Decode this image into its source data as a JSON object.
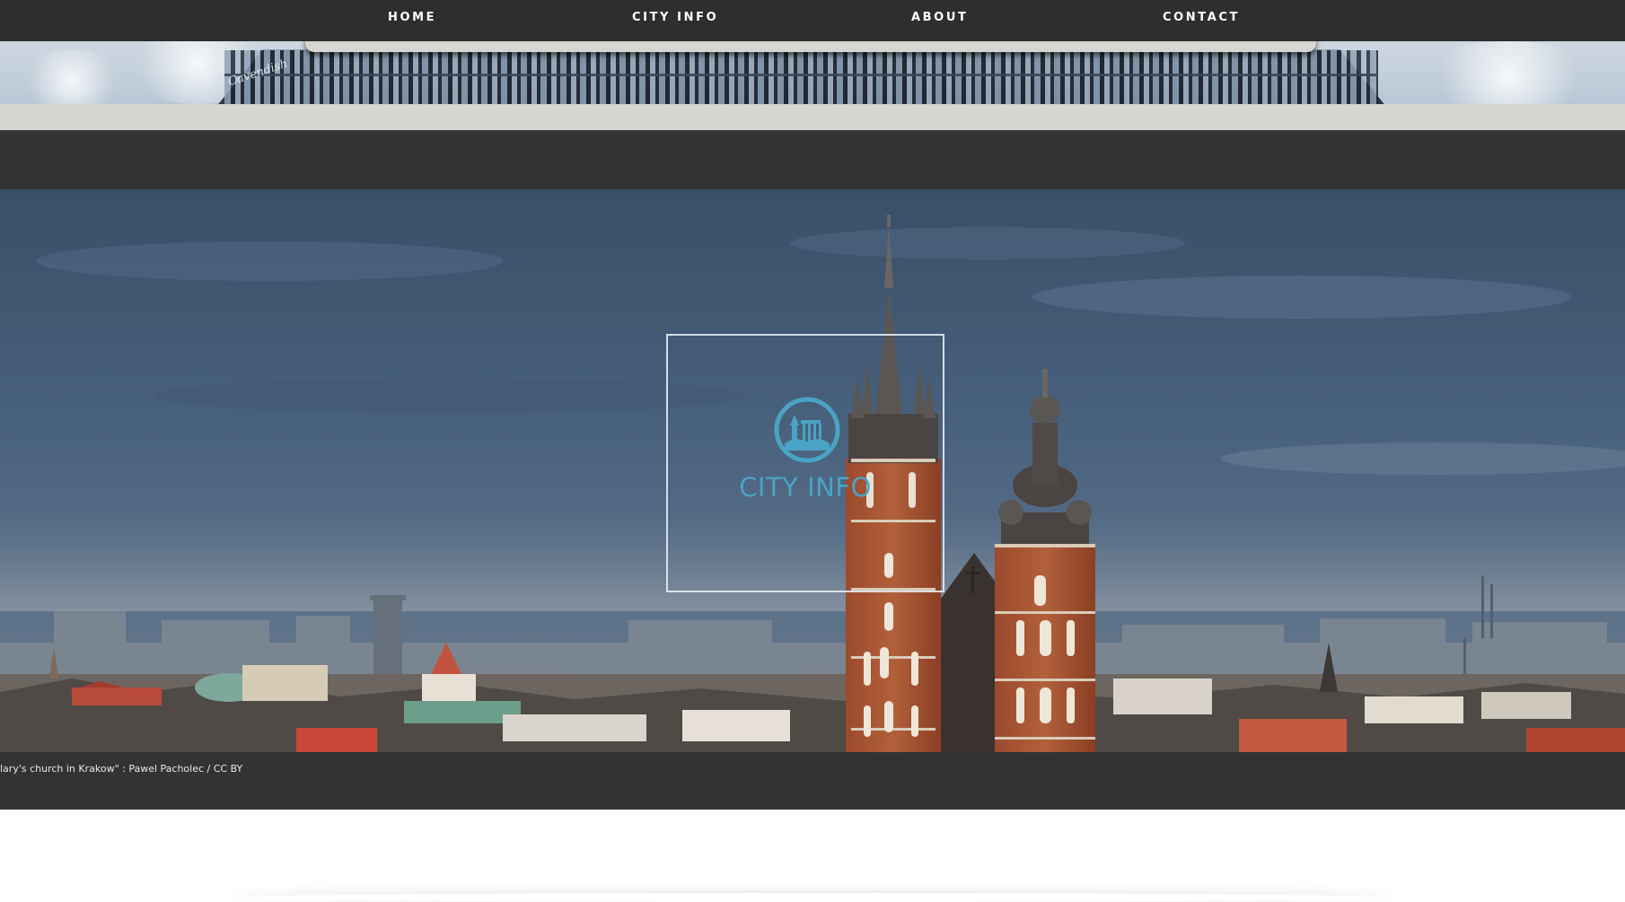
{
  "nav": {
    "items": [
      {
        "label": "HOME"
      },
      {
        "label": "CITY INFO"
      },
      {
        "label": "ABOUT"
      },
      {
        "label": "CONTACT"
      }
    ]
  },
  "header": {
    "building_sign": "Cavendish"
  },
  "hero": {
    "logo_text": "CITY INFO",
    "logo_icon": "city-skyline-icon",
    "caption": "lary's church in Krakow\" : Pawel Pacholec / CC BY"
  },
  "colors": {
    "nav_bg": "#2e2e2e",
    "band_beige": "#d8d6d0",
    "band_dark": "#333333",
    "logo_accent": "#4aa3c4"
  }
}
